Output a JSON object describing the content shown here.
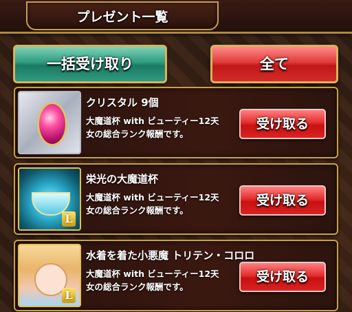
{
  "header": {
    "title": "プレゼント一覧"
  },
  "actions": {
    "bulk_receive_label": "一括受け取り",
    "all_filter_label": "全て"
  },
  "presents": [
    {
      "name": "クリスタル 9個",
      "desc_line1": "大魔道杯 with ビューティー12天",
      "desc_line2": "女の総合ランク報酬です。",
      "button_label": "受け取る",
      "icon": "crystal-icon"
    },
    {
      "name": "栄光の大魔道杯",
      "desc_line1": "大魔道杯 with ビューティー12天",
      "desc_line2": "女の総合ランク報酬です。",
      "button_label": "受け取る",
      "icon": "trophy-cup-icon"
    },
    {
      "name": "水着を着た小悪魔 トリテン・コロロ",
      "desc_line1": "大魔道杯 with ビューティー12天",
      "desc_line2": "女の総合ランク報酬です。",
      "button_label": "受け取る",
      "icon": "character-card-icon"
    }
  ],
  "colors": {
    "gold_border": "#c9a24a",
    "receive_red": "#e52d2d",
    "bulk_green": "#2e9b80"
  }
}
